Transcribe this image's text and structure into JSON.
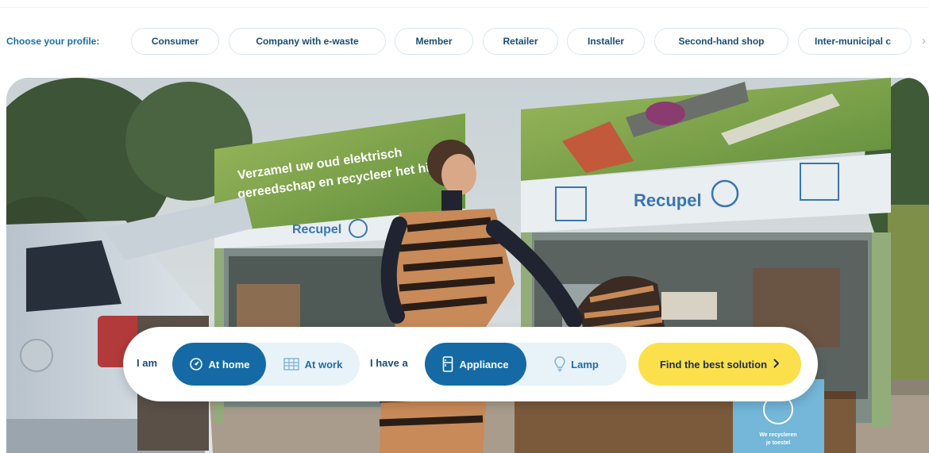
{
  "profile_bar": {
    "label": "Choose your profile:",
    "profiles": [
      "Consumer",
      "Company with e-waste",
      "Member",
      "Retailer",
      "Installer",
      "Second-hand shop",
      "Inter-municipal c"
    ],
    "scroll_arrow": "›"
  },
  "hero": {
    "banner_text_line1": "Verzamel uw oud elektrisch",
    "banner_text_line2": "gereedschap en recycleer het hi",
    "brand_logo_text": "Recupel",
    "bin_sign_line1": "We recycleren",
    "bin_sign_line2": "je toestel"
  },
  "selector": {
    "i_am_label": "I am",
    "location_options": [
      {
        "label": "At home",
        "icon": "home-meter-icon",
        "selected": true
      },
      {
        "label": "At work",
        "icon": "office-building-icon",
        "selected": false
      }
    ],
    "i_have_label": "I have a",
    "item_options": [
      {
        "label": "Appliance",
        "icon": "fridge-icon",
        "selected": true
      },
      {
        "label": "Lamp",
        "icon": "lightbulb-icon",
        "selected": false
      }
    ],
    "cta_label": "Find the best solution",
    "cta_icon": "chevron-right-icon"
  },
  "colors": {
    "primary_blue": "#156aa5",
    "text_navy": "#1a4d74",
    "cta_yellow": "#fbe04c",
    "toggle_bg": "#e8f2f9"
  }
}
